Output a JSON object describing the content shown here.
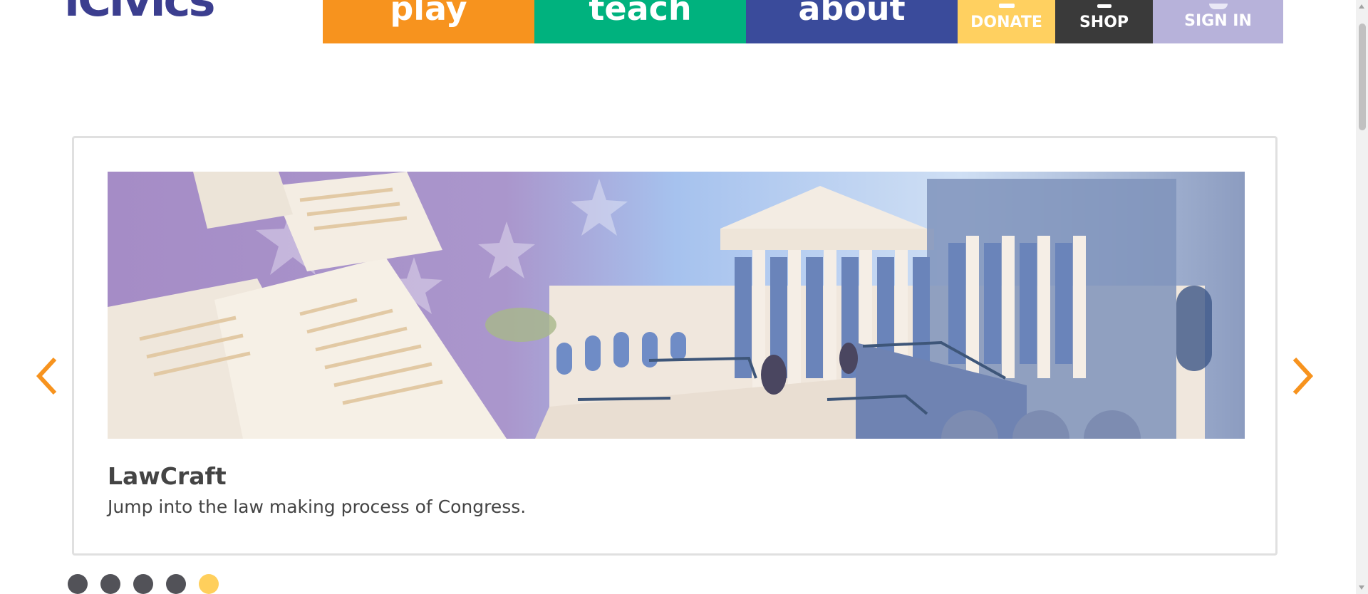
{
  "header": {
    "logo_text": "iCivics",
    "nav": {
      "play": "play",
      "teach": "teach",
      "about": "about",
      "donate": "DONATE",
      "shop": "SHOP",
      "signin": "SIGN IN"
    }
  },
  "carousel": {
    "slide": {
      "title": "LawCraft",
      "description": "Jump into the law making process of Congress."
    },
    "dots_total": 5,
    "active_dot": 5
  },
  "colors": {
    "play": "#f7931e",
    "teach": "#00b27e",
    "about": "#3a4b9b",
    "donate": "#ffd060",
    "shop": "#3a3a3a",
    "signin": "#b7b2da",
    "arrow": "#f7931e",
    "dot_active": "#ffcf5c",
    "dot_inactive": "#525258"
  },
  "icons": {
    "prev": "chevron-left-icon",
    "next": "chevron-right-icon"
  }
}
